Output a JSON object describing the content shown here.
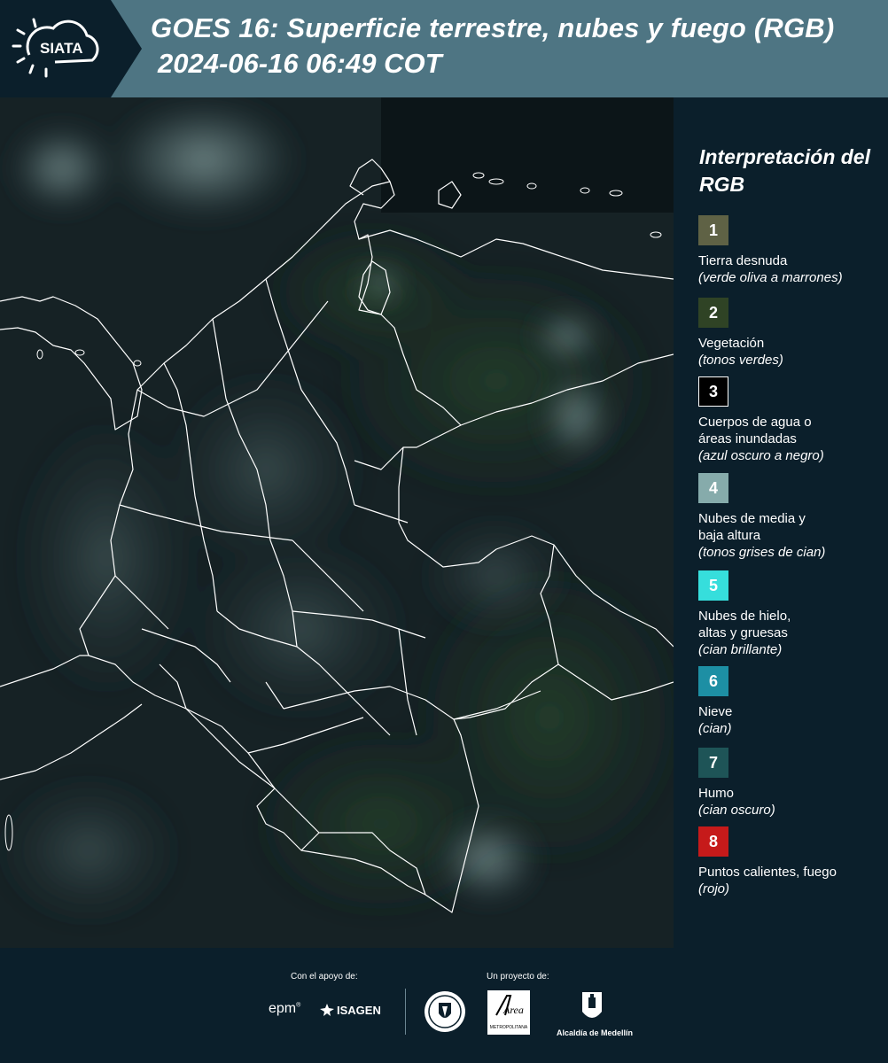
{
  "header": {
    "logo_text": "SIATA",
    "title": "GOES 16: Superficie terrestre, nubes y fuego (RGB)",
    "datetime": "2024-06-16 06:49 COT"
  },
  "map": {
    "description_icon": "satellite-rgb-map",
    "colors": {
      "ocean": "#0f1c22",
      "land": "#1c2c2a",
      "border": "#ffffff"
    }
  },
  "legend": {
    "title": "Interpretación del RGB",
    "items": [
      {
        "number": "1",
        "label": "Tierra desnuda",
        "desc": "(verde oliva a marrones)",
        "color": "#5f6245"
      },
      {
        "number": "2",
        "label": "Vegetación",
        "desc": "(tonos verdes)",
        "color": "#2f4325"
      },
      {
        "number": "3",
        "label": "Cuerpos de agua o áreas inundadas",
        "desc": "(azul oscuro a negro)",
        "color": "#000000"
      },
      {
        "number": "4",
        "label": "Nubes de media y baja altura",
        "desc": "(tonos grises de cian)",
        "color": "#86abab"
      },
      {
        "number": "5",
        "label": "Nubes de hielo, altas y gruesas",
        "desc": "(cian brillante)",
        "color": "#36dedc"
      },
      {
        "number": "6",
        "label": "Nieve",
        "desc": "(cian)",
        "color": "#1d8fa4"
      },
      {
        "number": "7",
        "label": "Humo",
        "desc": "(cian oscuro)",
        "color": "#1e5457"
      },
      {
        "number": "8",
        "label": "Puntos calientes, fuego",
        "desc": "(rojo)",
        "color": "#c61a1a"
      }
    ]
  },
  "footer": {
    "support_label": "Con el apoyo de:",
    "project_label": "Un proyecto de:",
    "sponsor1": "epm",
    "sponsor2": "ISAGEN",
    "partner1_sub": "METROPOLITANA",
    "partner1_name": "Área",
    "partner2": "Alcaldía de Medellín"
  }
}
